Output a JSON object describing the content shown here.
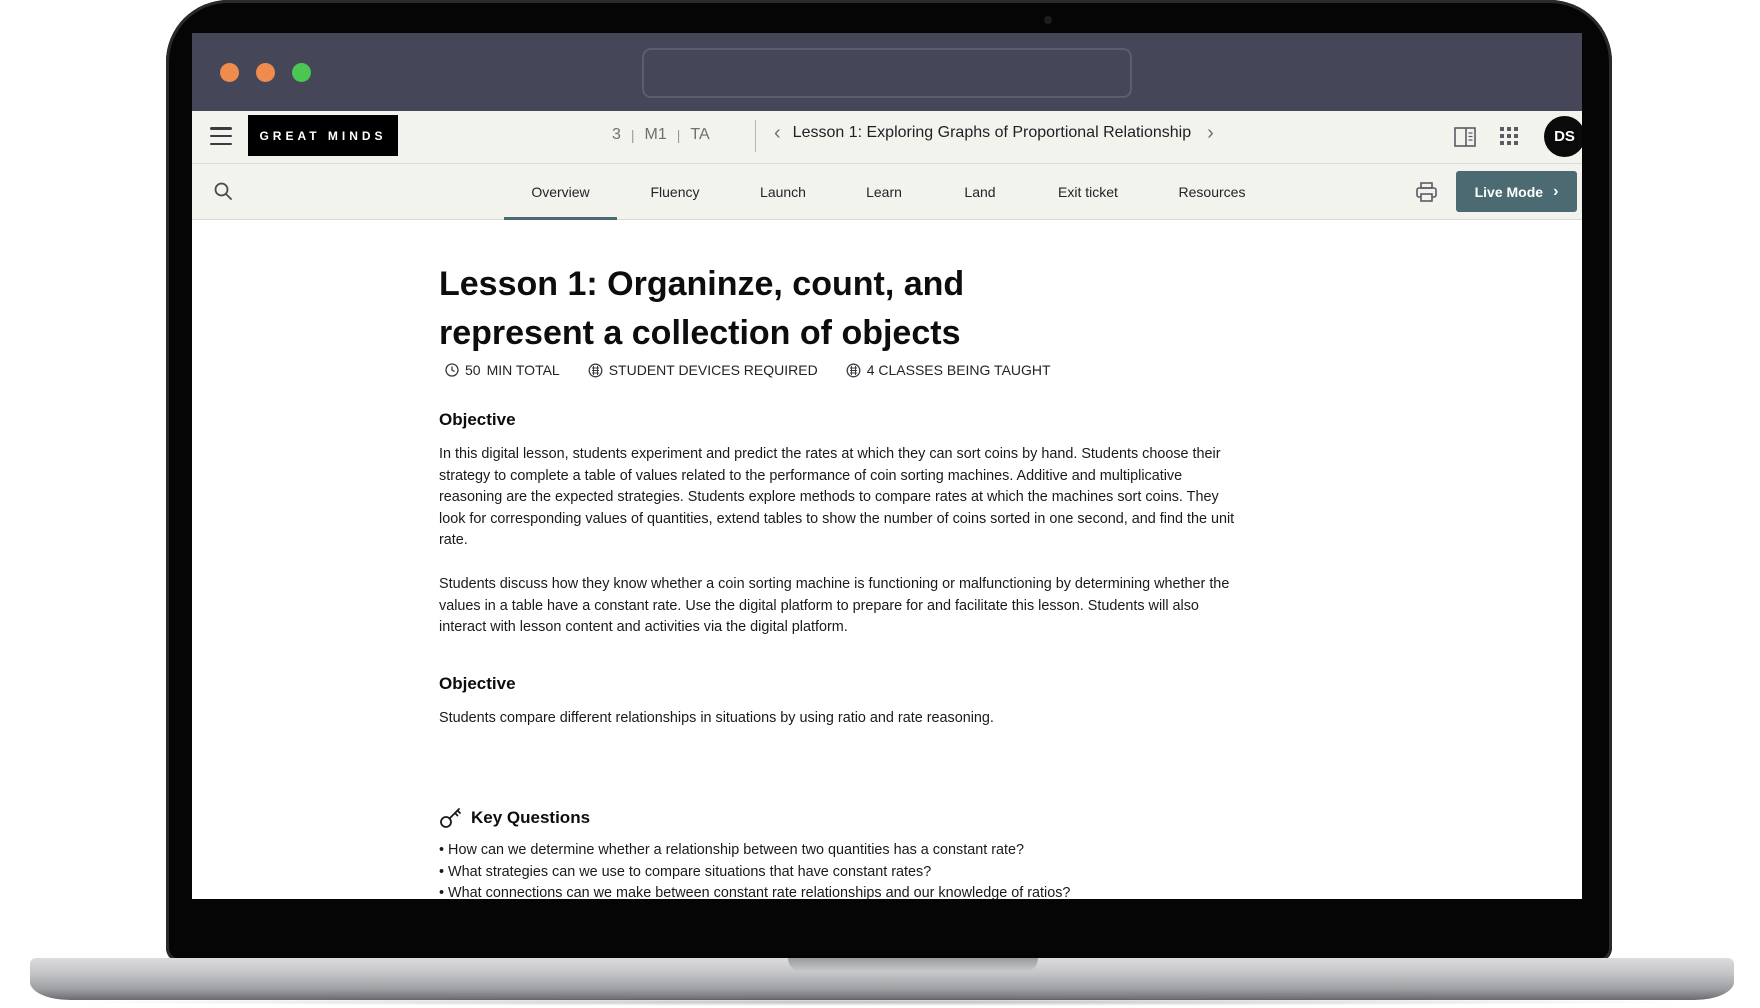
{
  "browser": {
    "window_controls": [
      "close",
      "minimize",
      "maximize"
    ],
    "url": ""
  },
  "header": {
    "logo_text": "GREAT MINDS",
    "breadcrumb": [
      "3",
      "M1",
      "TA"
    ],
    "lesson_nav_title": "Lesson 1: Exploring Graphs of Proportional Relationship",
    "avatar_initials": "DS",
    "icons": [
      "menu-icon",
      "side-panel-icon",
      "apps-grid-icon"
    ]
  },
  "tabs": {
    "items": [
      {
        "label": "Overview",
        "active": true
      },
      {
        "label": "Fluency",
        "active": false
      },
      {
        "label": "Launch",
        "active": false
      },
      {
        "label": "Learn",
        "active": false
      },
      {
        "label": "Land",
        "active": false
      },
      {
        "label": "Exit ticket",
        "active": false
      },
      {
        "label": "Resources",
        "active": false
      }
    ],
    "live_mode_label": "Live Mode"
  },
  "content": {
    "title": "Lesson 1: Organinze, count, and represent a collection of objects",
    "meta": {
      "minutes": "50",
      "minutes_label": "MIN TOTAL",
      "devices": "STUDENT DEVICES REQUIRED",
      "classes": "4 CLASSES BEING TAUGHT"
    },
    "objective_heading": "Objective",
    "objective_p1": "In this digital lesson, students experiment and predict the rates at which they can sort coins by hand. Students choose their strategy to complete a table of values related to the performance of coin sorting machines. Additive and multiplicative reasoning are the expected strategies. Students explore methods to compare rates at which the machines sort coins. They look for corresponding values of quantities, extend tables to show the number of coins sorted in one second, and find the unit rate.",
    "objective_p2": "Students discuss how they know whether a coin sorting machine is functioning or malfunctioning by determining whether the values in a table have a constant rate. Use the digital platform to prepare for and facilitate this lesson. Students will also interact with lesson content and activities via the digital platform.",
    "objective2_heading": "Objective",
    "objective2_p": "Students compare different relationships in situations by using ratio and rate reasoning.",
    "key_questions_heading": "Key Questions",
    "key_questions": [
      "How can we determine whether a relationship between two quantities has a constant rate?",
      "What strategies can we use to compare situations that have constant rates?",
      "What connections can we make between constant rate relationships and our knowledge of ratios?"
    ]
  },
  "colors": {
    "browser_bar": "#464659",
    "accent": "#4b6a72",
    "header_bg": "#f3f3ee",
    "dot_close": "#f08b4e",
    "dot_minimize": "#f08b4e",
    "dot_maximize": "#4cc652"
  }
}
